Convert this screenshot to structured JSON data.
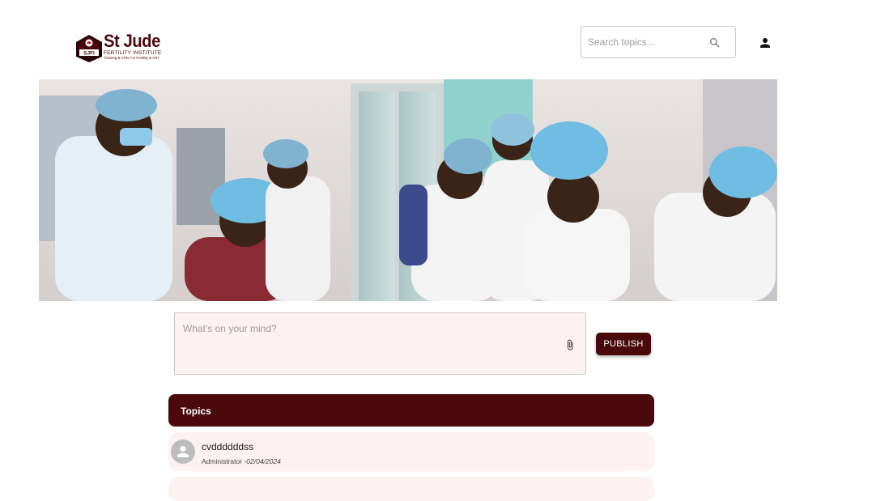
{
  "header": {
    "logo": {
      "name": "St Jude",
      "subtitle": "FERTILITY INSTITUTE",
      "tagline": "Training & CPD For Fertility & ART",
      "badge": "SJFI"
    },
    "search": {
      "placeholder": "Search topics..."
    },
    "icons": {
      "search": "search-icon",
      "user": "person-icon"
    }
  },
  "hero": {
    "description_icon": "hero-image"
  },
  "composer": {
    "placeholder": "What's on your mind?",
    "value": "",
    "attach_icon": "paperclip-icon"
  },
  "publish": {
    "label": "PUBLISH"
  },
  "topics": {
    "header": "Topics",
    "items": [
      {
        "title": "cvddddddss",
        "author": "Administrator",
        "date": "-02/04/2024"
      }
    ]
  },
  "colors": {
    "brand": "#4a0a0b",
    "row_bg": "#fdf2f2",
    "avatar": "#bdbdbd"
  }
}
